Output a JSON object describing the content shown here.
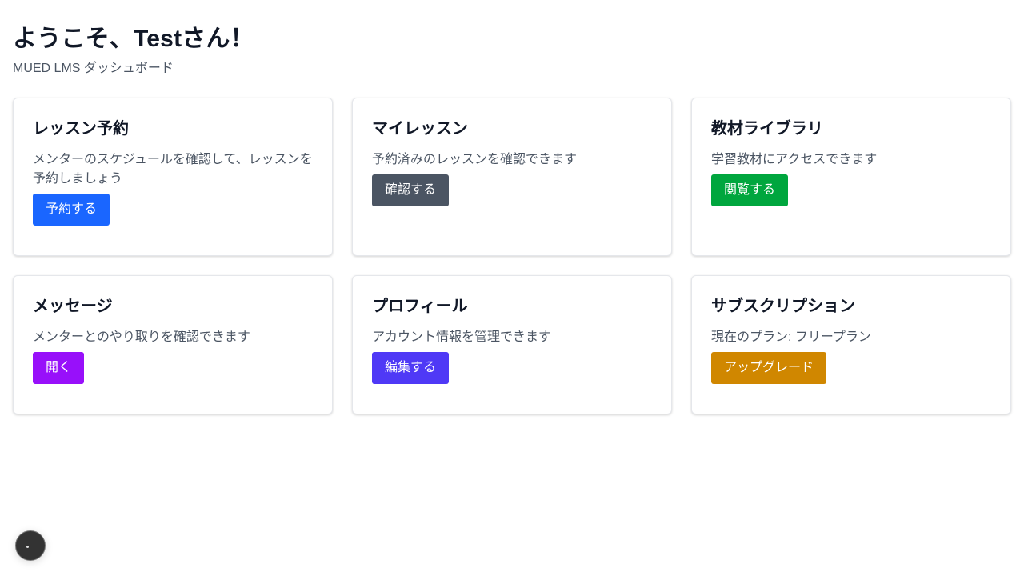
{
  "header": {
    "title": "ようこそ、Testさん！",
    "subtitle": "MUED LMS ダッシュボード"
  },
  "cards": [
    {
      "title": "レッスン予約",
      "description": "メンターのスケジュールを確認して、レッスンを予約しましょう",
      "button": "予約する",
      "button_color": "#1a66ff"
    },
    {
      "title": "マイレッスン",
      "description": "予約済みのレッスンを確認できます",
      "button": "確認する",
      "button_color": "#4b5563"
    },
    {
      "title": "教材ライブラリ",
      "description": "学習教材にアクセスできます",
      "button": "閲覧する",
      "button_color": "#00a63e"
    },
    {
      "title": "メッセージ",
      "description": "メンターとのやり取りを確認できます",
      "button": "開く",
      "button_color": "#9810fa"
    },
    {
      "title": "プロフィール",
      "description": "アカウント情報を管理できます",
      "button": "編集する",
      "button_color": "#4f39f6"
    },
    {
      "title": "サブスクリプション",
      "description": "現在のプラン: フリープラン",
      "button": "アップグレード",
      "button_color": "#d08700"
    }
  ],
  "floating_button": {
    "icon": "circle-menu-icon"
  }
}
